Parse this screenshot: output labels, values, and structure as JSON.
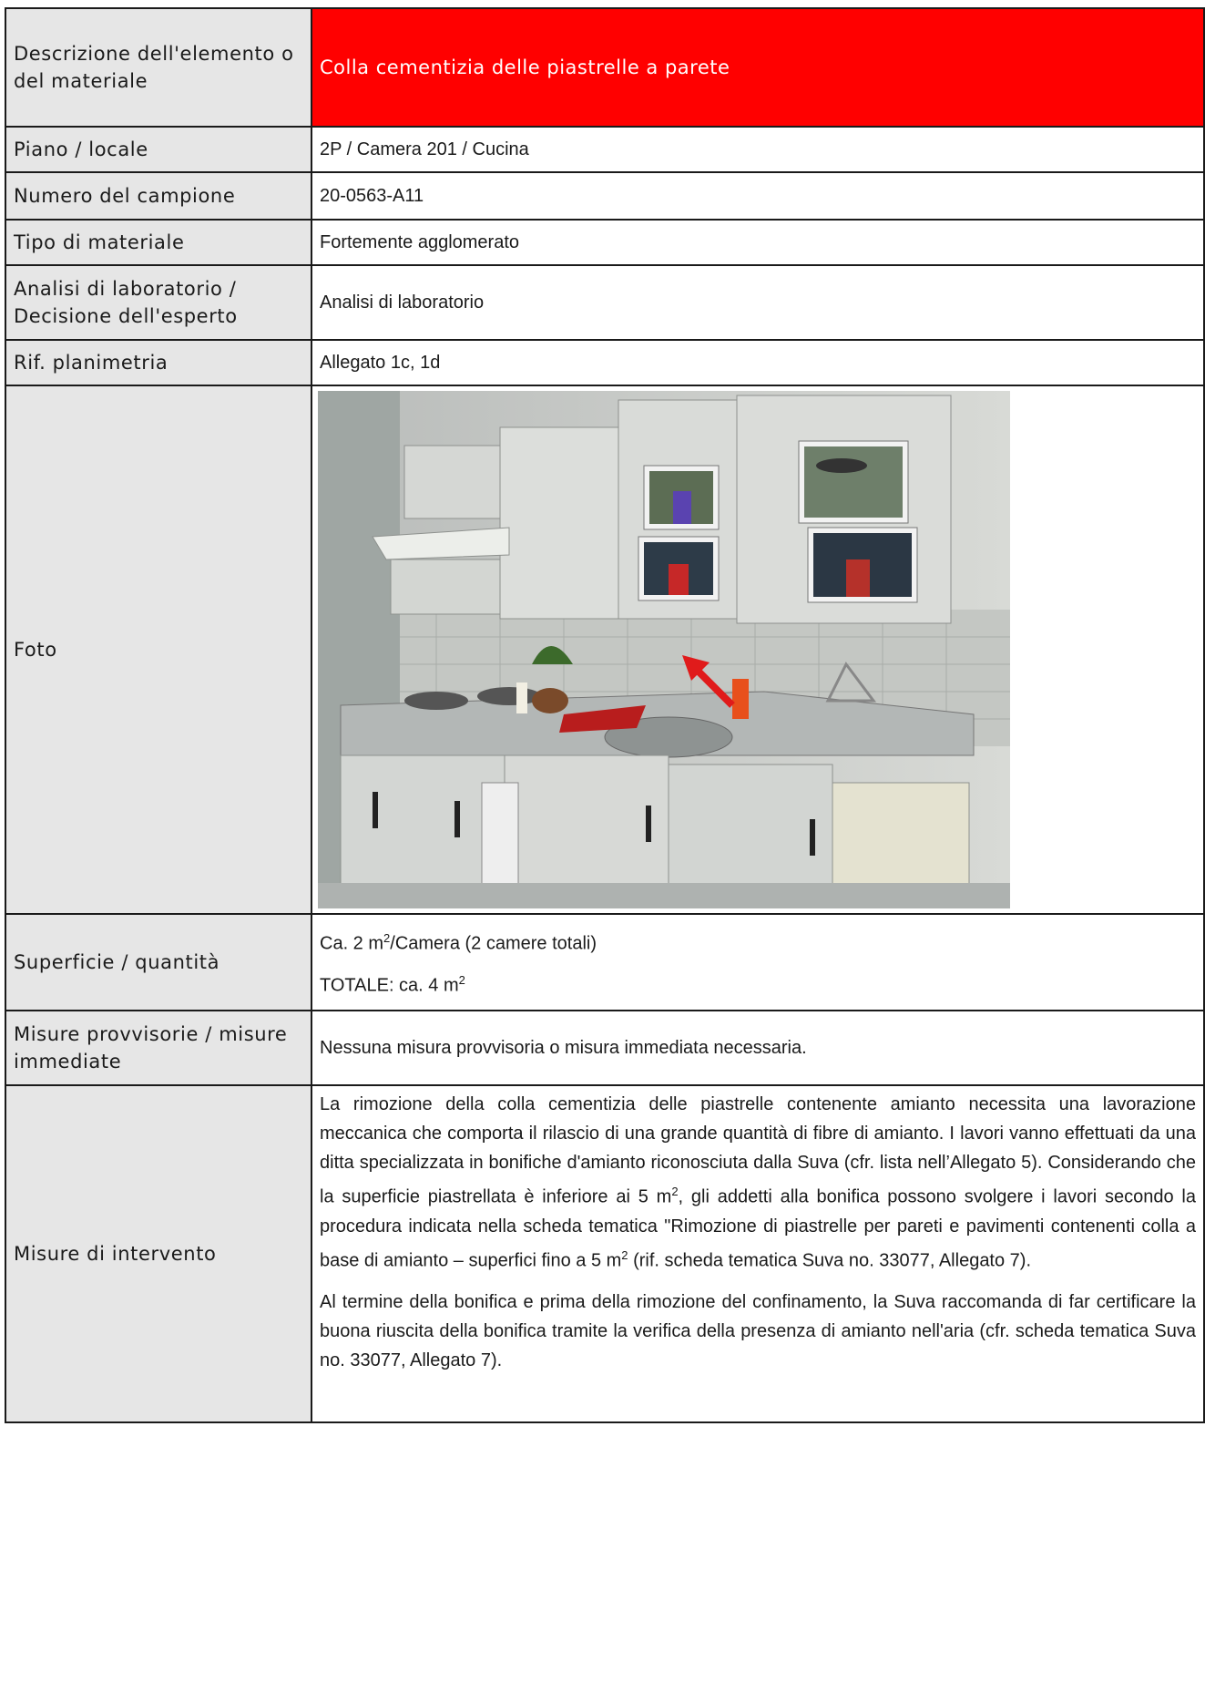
{
  "rows": {
    "descrizione": {
      "label": "Descrizione dell'elemento o del materiale",
      "value": "Colla cementizia delle piastrelle a parete"
    },
    "piano": {
      "label": "Piano / locale",
      "value": "2P / Camera 201 / Cucina"
    },
    "campione": {
      "label": "Numero del campione",
      "value": "20-0563-A11"
    },
    "tipo": {
      "label": "Tipo di materiale",
      "value": "Fortemente agglomerato"
    },
    "analisi": {
      "label": "Analisi di laboratorio / Decisione dell'esperto",
      "value": "Analisi di laboratorio"
    },
    "planimetria": {
      "label": "Rif. planimetria",
      "value": "Allegato 1c, 1d"
    },
    "foto": {
      "label": "Foto"
    },
    "superficie": {
      "label": "Superficie / quantità",
      "line1_a": "Ca. 2 m",
      "line1_b": "2",
      "line1_c": "/Camera (2 camere totali)",
      "line2_a": "TOTALE: ca. 4 m",
      "line2_b": "2"
    },
    "provvisorie": {
      "label": "Misure provvisorie / misure immediate",
      "value": "Nessuna misura provvisoria o misura immediata necessaria."
    },
    "intervento": {
      "label": "Misure di intervento",
      "p1_a": "La rimozione della colla cementizia delle piastrelle contenente amianto necessita una lavorazione meccanica che comporta il rilascio di una grande quantità di fibre di amianto. I lavori vanno effettuati da una ditta specializzata in bonifiche d'amianto riconosciuta dalla Suva (cfr. lista nell’Allegato 5). Considerando che la superficie piastrellata è inferiore ai 5 m",
      "p1_sup1": "2",
      "p1_b": ", gli addetti alla bonifica possono svolgere i lavori secondo la procedura indicata nella scheda tematica \"Rimozione di piastrelle per pareti e pavimenti contenenti colla a base di amianto – superfici fino a 5 m",
      "p1_sup2": "2",
      "p1_c": " (rif. scheda tematica Suva no. 33077, Allegato 7).",
      "p2": "Al termine della bonifica e prima della rimozione del confinamento, la Suva raccomanda di far certificare la buona riuscita della bonifica tramite la verifica della presenza di amianto nell'aria (cfr. scheda tematica Suva no. 33077, Allegato 7)."
    }
  },
  "colors": {
    "header_bg": "#ff0000",
    "label_bg": "#e6e6e6",
    "border": "#1a1a1a"
  }
}
